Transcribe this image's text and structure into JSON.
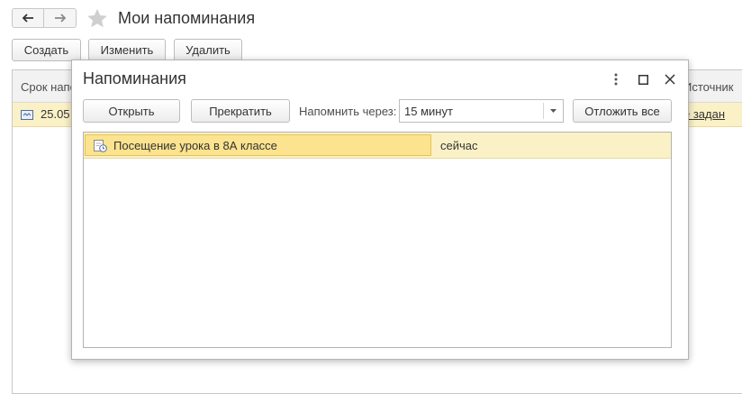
{
  "window": {
    "title": "Мои напоминания",
    "toolbar": {
      "create_label": "Создать",
      "edit_label": "Изменить",
      "delete_label": "Удалить"
    }
  },
  "table": {
    "columns": [
      "Срок напо",
      "Источник"
    ],
    "rows": [
      {
        "date": "25.05",
        "source": "е задан"
      }
    ]
  },
  "dialog": {
    "title": "Напоминания",
    "open_label": "Открыть",
    "stop_label": "Прекратить",
    "remind_in_label": "Напомнить через:",
    "remind_in_value": "15 минут",
    "postpone_all_label": "Отложить все",
    "items": [
      {
        "name": "Посещение урока в 8А классе",
        "time": "сейчас"
      }
    ]
  },
  "icons": [
    "back-arrow-icon",
    "forward-arrow-icon",
    "star-icon",
    "more-vertical-icon",
    "maximize-icon",
    "close-icon",
    "calendar-event-icon",
    "reminder-icon",
    "chevron-down-icon"
  ],
  "colors": {
    "selected_row": "#fbf1c6",
    "selected_cell": "#fbe38f",
    "border": "#bdbdbd"
  }
}
